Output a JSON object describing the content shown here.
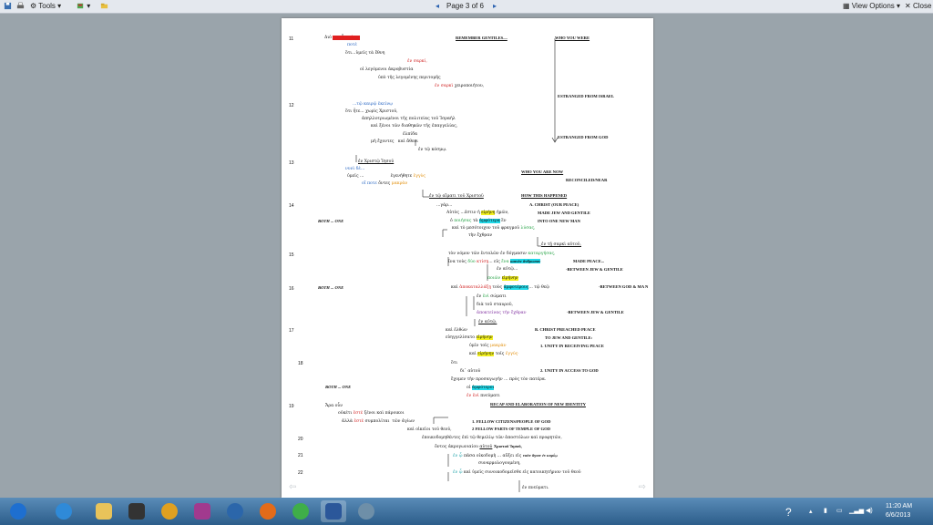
{
  "toolbar": {
    "tools_label": "Tools",
    "page_indicator": "Page 3 of 6",
    "view_options_label": "View Options",
    "close_label": "Close"
  },
  "doc": {
    "verse_numbers": [
      "11",
      "12",
      "13",
      "14",
      "15",
      "16",
      "17",
      "18",
      "19",
      "20",
      "21",
      "22"
    ],
    "headings": {
      "remember": "REMEMBER GENTILES....",
      "who_you_were": "WHO YOU WERE",
      "estranged_israel": "ESTRANGED FROM ISRAEL",
      "estranged_god": "ESTRANGED FROM GOD",
      "who_you_are_now": "WHO YOU ARE NOW",
      "reconciled": "RECONCILED/NEAR",
      "how_this_happened": "HOW THIS HAPPENED",
      "christ_our_peace": "A. CHRIST (OUR PEACE)",
      "made_jew": "MADE  JEW AND GENTILE",
      "into_one": "INTO ONE NEW MAN",
      "made_peace": "MADE PEACE...",
      "between_jew1": "-BETWEEN JEW & GENTILE",
      "between_god": "-BETWEEN GOD & MA N",
      "between_jew2": "-BETWEEN JEW & GENTILE",
      "christ_preached": "B.  CHRIST PREACHED PEACE",
      "to_jew": "TO JEW AND GENTILE:",
      "unity_peace": "1.  UNITY IN RECEIVING PEACE",
      "unity_access": "2.  UNITY IN ACCESS TO GOD",
      "recap": "RECAP AND ELABORATION OF NEW IDENTITY",
      "fellow_citizens": "1. FELLOW CITIZENS/PEOPLE OF GOD",
      "fellow_parts": "2 FELLOW PARTS OF TEMPLE OF GOD",
      "both_one": "BOTH ... ONE"
    },
    "lines": {
      "l1": "Διὸ",
      "l1hl": "μνημονεύετε",
      "l2": "ποτὲ",
      "l3": "ὅτι...ὑμεῖς τὰ ἔθνη",
      "l4": "ἐν σαρκί,",
      "l5": "οἱ λεγόμενοι ἀκροβυστία",
      "l6": "ὑπὸ τῆς λεγομένης περιτομῆς",
      "l7a": "ἐν σαρκὶ",
      "l7b": "χειροποιήτου,",
      "l8": "...τῷ καιρῷ ἐκείνῳ",
      "l9": "ὅτι ἦτε... χωρὶς Χριστοῦ,",
      "l10": "ἀπηλλοτριωμένοι τῆς πολιτείας τοῦ Ἰσραὴλ",
      "l11": "καὶ ξένοι τῶν διαθηκῶν τῆς ἐπαγγελίας,",
      "l12": "ἐλπίδα",
      "l13a": "μὴ ἔχοντες",
      "l13b": "καὶ ἄθεοι",
      "l14": "ἐν τῷ κόσμῳ.",
      "l15": "ἐν Χριστῷ Ἰησοῦ",
      "l16": "νυνὶ δὲ...",
      "l17a": "ὑμεῖς ...",
      "l17b": "ἐγενήθητε",
      "l17c": "ἐγγὺς",
      "l18a": "οἵ ποτε",
      "l18b": "ὄντες",
      "l18c": "μακρὰν",
      "l19": "ἐν τῷ αἵματι τοῦ Χριστοῦ",
      "l20": "...γάρ...",
      "l21a": "Αὐτὸς ...ἐστιν ἡ",
      "l21b": "εἰρήνη",
      "l21c": "ἡμῶν,",
      "l22a": "ὁ",
      "l22b": "ποιήσας",
      "l22c": "τὰ",
      "l22d": "ἀμφότερα",
      "l22e": "ἓν",
      "l23a": "καὶ τὸ μεσότοιχον τοῦ φραγμοῦ",
      "l23b": "λύσας,",
      "l24": "τὴν ἔχθραν",
      "l25": "ἐν τῇ σαρκὶ αὐτοῦ,",
      "l26a": "τὸν νόμον τῶν ἐντολῶν ἐν δόγμασιν",
      "l26b": "καταργήσας,",
      "l27a": "ἵνα τοὺς",
      "l27b": "δύο",
      "l27c": "κτίσῃ",
      "l27d": "... εἰς",
      "l27e": "ἕνα",
      "l27f": "καινὸν ἄνθρωπον",
      "l28": "ἐν αὐτῷ...",
      "l29a": "ποιῶν",
      "l29b": "εἰρήνην",
      "l30a": "καὶ",
      "l30b": "ἀποκαταλλάξῃ",
      "l30c": "τοὺς",
      "l30d": "ἀμφοτέρους",
      "l30e": "... τῷ θεῷ",
      "l31a": "ἐν",
      "l31b": "ἑνὶ",
      "l31c": "σώματι",
      "l32": "διὰ τοῦ σταυροῦ,",
      "l33": "ἀποκτείνας τὴν ἔχθραν",
      "l34": "ἐν αὐτῷ.",
      "l35": "καὶ ἐλθὼν",
      "l36a": "εὐηγγελίσατο",
      "l36b": "εἰρήνην",
      "l37a": "ὑμῖν",
      "l37b": "τοῖς",
      "l37c": "μακρὰν",
      "l38a": "καὶ",
      "l38b": "εἰρήνην",
      "l38c": "τοῖς",
      "l38d": "ἐγγύς·",
      "l39": "ὅτι",
      "l40": "δι᾽ αὐτοῦ",
      "l41": "ἔχομεν τὴν προσαγωγὴν ... πρὸς τὸν πατέρα.",
      "l42a": "οἱ",
      "l42b": "ἀμφότεροι",
      "l43a": "ἐν",
      "l43b": "ἑνὶ",
      "l43c": "πνεύματι",
      "l44": "Ἄρα οὖν",
      "l45a": "οὐκέτι",
      "l45b": "ἐστὲ",
      "l45c": "ξένοι καὶ πάροικοι",
      "l46a": "ἀλλὰ",
      "l46b": "ἐστὲ",
      "l46c": "συμπολῖται",
      "l46d": "τῶν ἁγίων",
      "l47": "καὶ οἰκεῖοι τοῦ θεοῦ,",
      "l48": "ἐποικοδομηθέντες ἐπὶ τῷ θεμελίῳ τῶν ἀποστόλων καὶ προφητῶν,",
      "l49a": "ὄντος ἀκρογωνιαίου",
      "l49b": "αὐτοῦ",
      "l49c": "Χριστοῦ Ἰησοῦ,",
      "l50a": "ἐν ᾧ",
      "l50b": "πᾶσα οἰκοδομὴ ... αὔξει εἰς",
      "l50c": "ναὸν ἅγιον ἐν κυρίῳ",
      "l51": "συναρμολογουμένη,",
      "l52a": "ἐν ᾧ",
      "l52b": "καὶ ὑμεῖς συνοικοδομεῖσθε εἰς κατοικητήριον  τοῦ θεοῦ",
      "l53": "ἐν πνεύματι."
    }
  },
  "tray": {
    "time": "11:20 AM",
    "date": "6/6/2013"
  },
  "colors": {
    "taskbar": "#2c5d8a",
    "viewer_bg": "#9aa4ab",
    "highlight_yellow": "#f2f020",
    "highlight_cyan": "#20d8e8",
    "highlight_red": "#e02020"
  }
}
